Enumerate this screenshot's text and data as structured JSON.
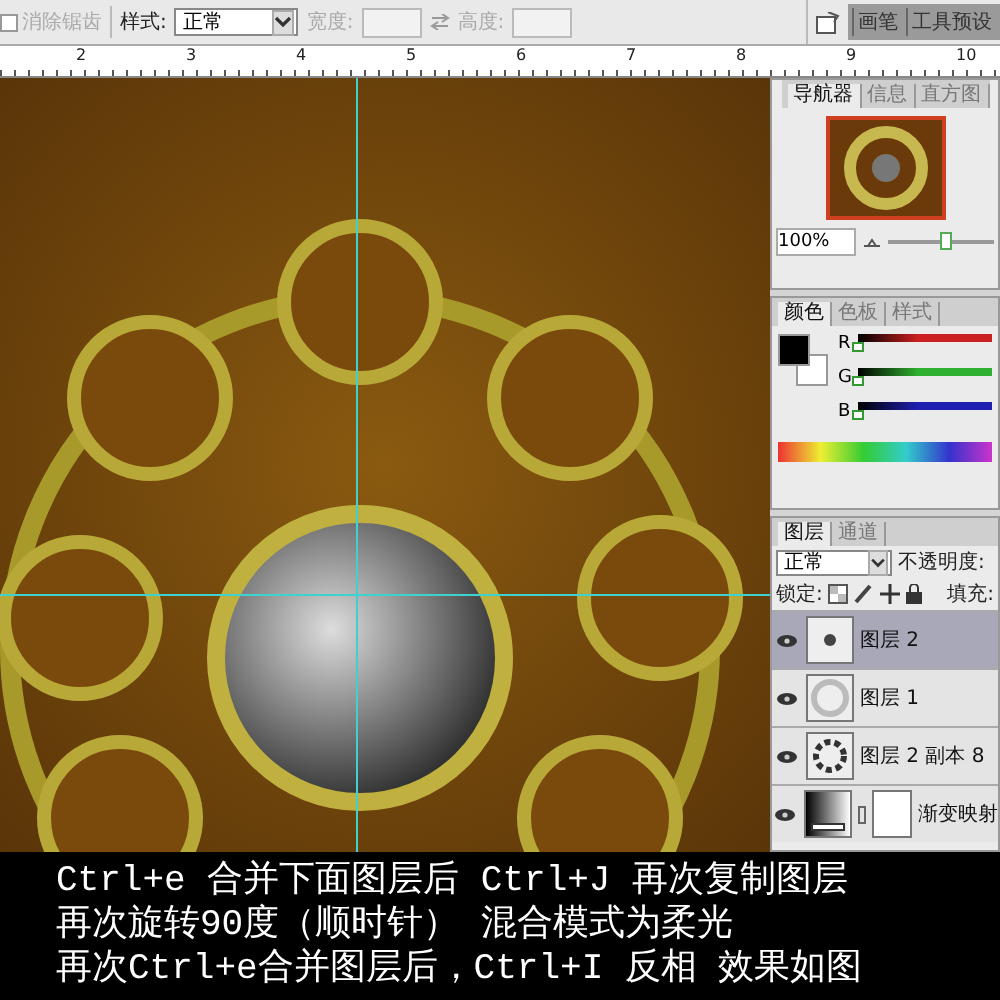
{
  "toolbar": {
    "anti_alias": {
      "label": "消除锯齿",
      "disabled": true
    },
    "style_label": "样式:",
    "style_value": "正常",
    "width_label": "宽度:",
    "height_label": "高度:",
    "panel_tabs": [
      "画笔",
      "工具预设"
    ]
  },
  "ruler": {
    "ticks": [
      "2",
      "3",
      "4",
      "5",
      "6",
      "7",
      "8",
      "9",
      "10"
    ]
  },
  "navigator": {
    "tabs": [
      {
        "label": "导航器",
        "selected": true
      },
      {
        "label": "信息",
        "selected": false
      },
      {
        "label": "直方图",
        "selected": false
      }
    ],
    "zoom": "100%",
    "level": 0.55
  },
  "color": {
    "tabs": [
      {
        "label": "颜色",
        "selected": true
      },
      {
        "label": "色板",
        "selected": false
      },
      {
        "label": "样式",
        "selected": false
      }
    ],
    "sliders": [
      {
        "label": "R",
        "level": 0,
        "color": "#cc2020"
      },
      {
        "label": "G",
        "level": 0,
        "color": "#30b030"
      },
      {
        "label": "B",
        "level": 0,
        "color": "#2020b0"
      }
    ]
  },
  "layers": {
    "tabs": [
      {
        "label": "图层",
        "selected": true
      },
      {
        "label": "通道",
        "selected": false
      }
    ],
    "blend_mode": "正常",
    "opacity_label": "不透明度:",
    "lock_label": "锁定:",
    "fill_label": "填充:",
    "items": [
      {
        "name": "图层 2",
        "selected": true,
        "visible": true,
        "kind": "dot"
      },
      {
        "name": "图层 1",
        "selected": false,
        "visible": true,
        "kind": "pattern"
      },
      {
        "name": "图层 2 副本 8",
        "selected": false,
        "visible": true,
        "kind": "ring"
      },
      {
        "name": "渐变映射",
        "selected": false,
        "visible": true,
        "kind": "adjustment"
      }
    ]
  },
  "caption": [
    "Ctrl+e 合并下面图层后 Ctrl+J 再次复制图层",
    "再次旋转90度（顺时针） 混合模式为柔光",
    "再次Ctrl+e合并图层后，Ctrl+I 反相  效果如图"
  ]
}
